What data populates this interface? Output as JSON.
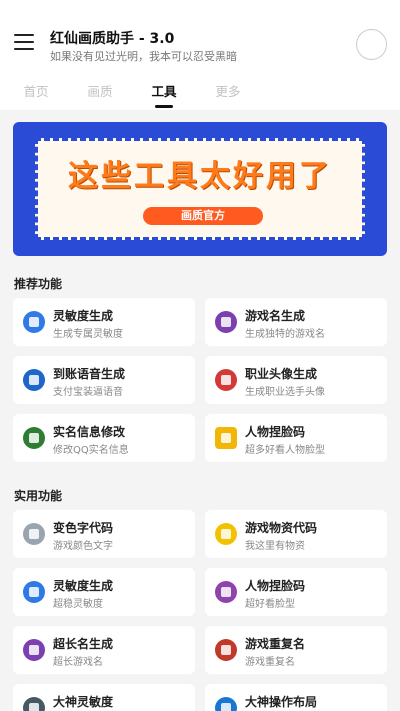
{
  "header": {
    "title": "红仙画质助手 - 3.0",
    "subtitle": "如果没有见过光明，我本可以忍受黑暗"
  },
  "tabs": [
    {
      "label": "首页"
    },
    {
      "label": "画质"
    },
    {
      "label": "工具"
    },
    {
      "label": "更多"
    }
  ],
  "active_tab": "工具",
  "banner": {
    "title": "这些工具太好用了",
    "badge": "画质官方"
  },
  "sections": [
    {
      "title": "推荐功能",
      "items": [
        {
          "title": "灵敏度生成",
          "sub": "生成专属灵敏度",
          "icon": "blue-device-icon"
        },
        {
          "title": "游戏名生成",
          "sub": "生成独特的游戏名",
          "icon": "gameboy-icon"
        },
        {
          "title": "到账语音生成",
          "sub": "支付宝装逼语音",
          "icon": "payment-voice-icon"
        },
        {
          "title": "职业头像生成",
          "sub": "生成职业选手头像",
          "icon": "gamepad-icon"
        },
        {
          "title": "实名信息修改",
          "sub": "修改QQ实名信息",
          "icon": "shield-icon"
        },
        {
          "title": "人物捏脸码",
          "sub": "超多好看人物脸型",
          "icon": "face-card-icon"
        }
      ]
    },
    {
      "title": "实用功能",
      "items": [
        {
          "title": "变色字代码",
          "sub": "游戏颜色文字",
          "icon": "rocket-icon"
        },
        {
          "title": "游戏物资代码",
          "sub": "我这里有物资",
          "icon": "spider-icon"
        },
        {
          "title": "灵敏度生成",
          "sub": "超稳灵敏度",
          "icon": "blue-device-icon"
        },
        {
          "title": "人物捏脸码",
          "sub": "超好看脸型",
          "icon": "capsule-icon"
        },
        {
          "title": "超长名生成",
          "sub": "超长游戏名",
          "icon": "gameboy-icon"
        },
        {
          "title": "游戏重复名",
          "sub": "游戏重复名",
          "icon": "cherry-icon"
        },
        {
          "title": "大神灵敏度",
          "sub": "",
          "icon": "laptop-icon"
        },
        {
          "title": "大神操作布局",
          "sub": "",
          "icon": "monitor-icon"
        }
      ]
    }
  ],
  "colors": {
    "banner_bg": "#2a4bd6",
    "banner_title": "#ff7a1a",
    "badge": "#ff5a1f",
    "page_bg": "#f4f4f4"
  }
}
